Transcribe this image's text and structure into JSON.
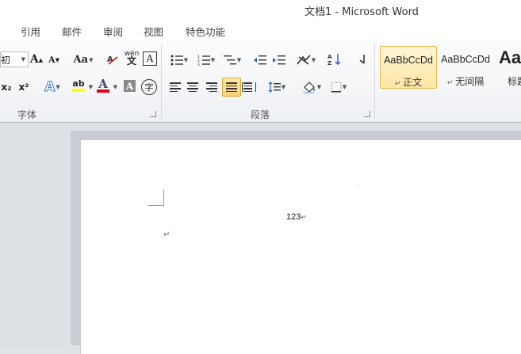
{
  "window": {
    "title": "文档1  -  Microsoft Word"
  },
  "tabs": [
    "引用",
    "邮件",
    "审阅",
    "视图",
    "特色功能"
  ],
  "font_group": {
    "label": "字体",
    "size_value": "初",
    "grow_icon": "A",
    "shrink_icon": "A",
    "case_label": "Aa",
    "phonetic_label": "wén",
    "char_border_label": "A",
    "subscript_label": "x₂",
    "superscript_label": "x²",
    "text_effect_label": "A",
    "highlight_label": "ab",
    "font_color_label": "A",
    "char_shading_label": "A",
    "enclose_label": "字",
    "colors": {
      "highlight": "#ffff00",
      "font_color": "#e0001b"
    }
  },
  "paragraph_group": {
    "label": "段落"
  },
  "styles": [
    {
      "sample": "AaBbCcDd",
      "name": "正文"
    },
    {
      "sample": "AaBbCcDd",
      "name": "无间隔"
    },
    {
      "sample": "Aa",
      "name": "标题"
    }
  ],
  "document": {
    "text": "123",
    "para_mark": "↵"
  }
}
